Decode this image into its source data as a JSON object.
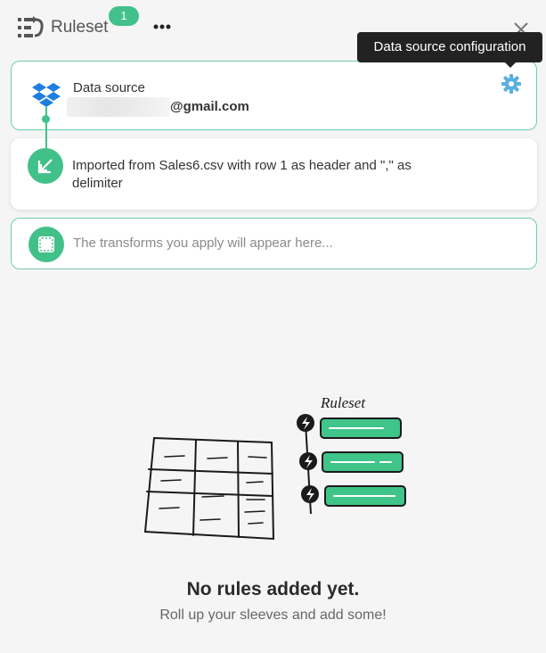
{
  "header": {
    "title": "Ruleset",
    "badge_count": "1"
  },
  "tooltip": {
    "text": "Data source configuration"
  },
  "data_source": {
    "label": "Data source",
    "email_suffix": "@gmail.com"
  },
  "import": {
    "text": "Imported from Sales6.csv with row 1 as header and \",\" as delimiter"
  },
  "transforms": {
    "placeholder": "The transforms you apply will appear here..."
  },
  "illustration": {
    "caption": "Ruleset"
  },
  "empty_state": {
    "title": "No rules added yet.",
    "subtitle": "Roll up your sleeves and add some!"
  },
  "colors": {
    "accent": "#42c08a",
    "gear": "#5aaee0",
    "dropbox": "#1d7fe0"
  }
}
